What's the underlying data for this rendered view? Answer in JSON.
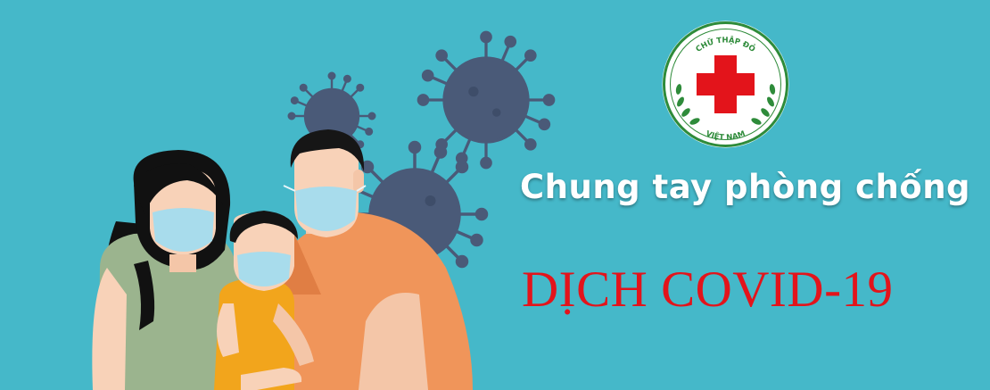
{
  "banner": {
    "headline": "Chung tay phòng chống",
    "subhead": "DỊCH COVID-19"
  },
  "logo": {
    "top_text": "CHỮ THẬP ĐỎ",
    "bottom_text": "VIỆT NAM",
    "icon": "red-cross-icon",
    "ring_color": "#2e8b3a",
    "cross_color": "#e3141b"
  },
  "colors": {
    "background": "#45b8c9",
    "headline": "#ffffff",
    "subhead": "#e3141b",
    "virus": "#4a5a78"
  }
}
